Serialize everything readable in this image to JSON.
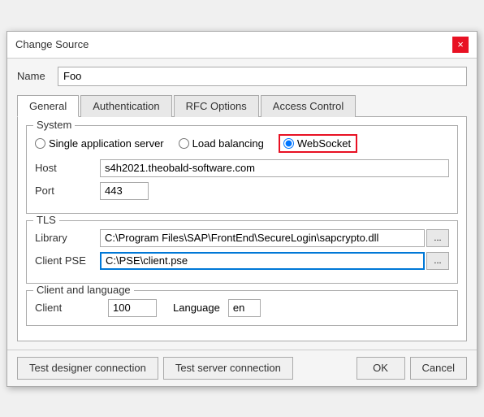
{
  "titleBar": {
    "title": "Change Source",
    "closeLabel": "×"
  },
  "nameField": {
    "label": "Name",
    "value": "Foo",
    "placeholder": ""
  },
  "tabs": [
    {
      "label": "General",
      "active": true
    },
    {
      "label": "Authentication",
      "active": false
    },
    {
      "label": "RFC Options",
      "active": false
    },
    {
      "label": "Access Control",
      "active": false
    }
  ],
  "system": {
    "legend": "System",
    "options": [
      {
        "label": "Single application server",
        "name": "server-type",
        "checked": false
      },
      {
        "label": "Load balancing",
        "name": "server-type",
        "checked": false
      },
      {
        "label": "WebSocket",
        "name": "server-type",
        "checked": true,
        "highlighted": true
      }
    ],
    "host": {
      "label": "Host",
      "value": "s4h2021.theobald-software.com"
    },
    "port": {
      "label": "Port",
      "value": "443"
    }
  },
  "tls": {
    "legend": "TLS",
    "library": {
      "label": "Library",
      "value": "C:\\Program Files\\SAP\\FrontEnd\\SecureLogin\\sapcrypto.dll",
      "browseLabel": "..."
    },
    "clientPse": {
      "label": "Client PSE",
      "value": "C:\\PSE\\client.pse",
      "browseLabel": "..."
    }
  },
  "clientLanguage": {
    "legend": "Client and language",
    "clientLabel": "Client",
    "clientValue": "100",
    "languageLabel": "Language",
    "languageValue": "en"
  },
  "footer": {
    "testDesigner": "Test designer connection",
    "testServer": "Test server connection",
    "ok": "OK",
    "cancel": "Cancel"
  }
}
